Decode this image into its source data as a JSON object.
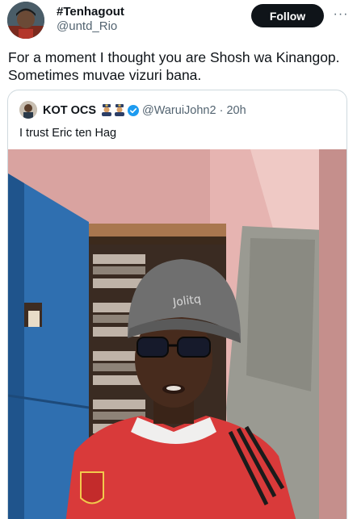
{
  "tweet": {
    "author_name": "#Tenhagout",
    "author_handle": "@untd_Rio",
    "follow_label": "Follow",
    "more_glyph": "···",
    "text": "For a moment I thought you are Shosh wa Kinangop. Sometimes muvae vizuri bana."
  },
  "quote": {
    "author_name": "KOT OCS",
    "emoji_icons": [
      "police-officer-emoji",
      "police-officer-emoji"
    ],
    "verified_icon": "verified-badge-icon",
    "handle_time": "@WaruiJohn2 · 20h",
    "text": "I trust Eric ten Hag"
  },
  "photo": {
    "beanie_text": "Jolitq"
  },
  "colors": {
    "follow_bg": "#0f1419",
    "secondary_text": "#536471",
    "verified_blue": "#1d9bf0",
    "border": "#cfd9de"
  }
}
